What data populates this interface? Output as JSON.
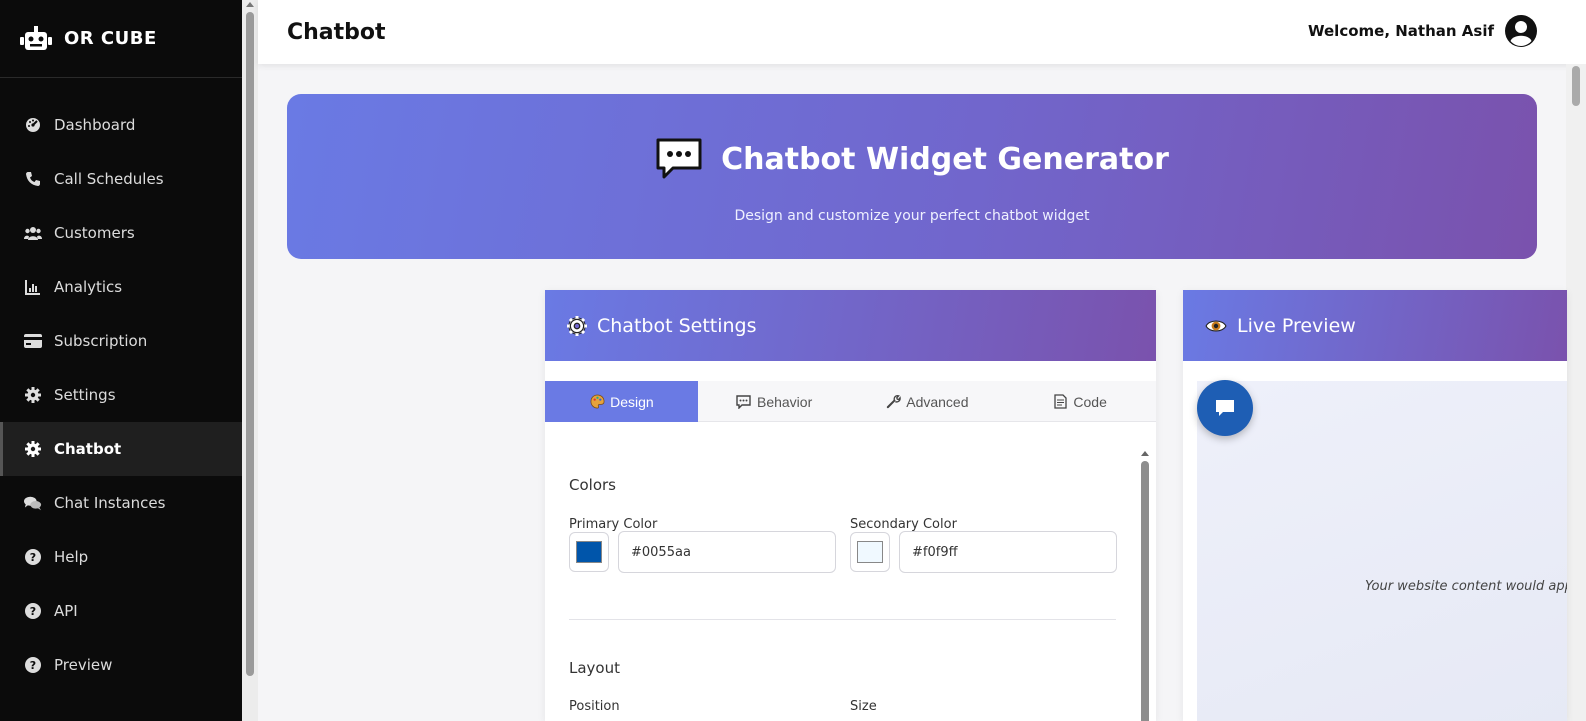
{
  "brand": {
    "name": "OR CUBE",
    "icon": "robot-icon"
  },
  "sidebar": {
    "items": [
      {
        "label": "Dashboard",
        "icon": "dashboard-icon",
        "active": false
      },
      {
        "label": "Call Schedules",
        "icon": "phone-icon",
        "active": false
      },
      {
        "label": "Customers",
        "icon": "users-icon",
        "active": false
      },
      {
        "label": "Analytics",
        "icon": "chart-icon",
        "active": false
      },
      {
        "label": "Subscription",
        "icon": "credit-card-icon",
        "active": false
      },
      {
        "label": "Settings",
        "icon": "gear-icon",
        "active": false
      },
      {
        "label": "Chatbot",
        "icon": "gear-icon",
        "active": true
      },
      {
        "label": "Chat Instances",
        "icon": "comments-icon",
        "active": false
      },
      {
        "label": "Help",
        "icon": "question-icon",
        "active": false
      },
      {
        "label": "API",
        "icon": "question-icon",
        "active": false
      },
      {
        "label": "Preview",
        "icon": "question-icon",
        "active": false
      }
    ]
  },
  "header": {
    "title": "Chatbot",
    "welcome": "Welcome, Nathan Asif",
    "avatar_icon": "user-circle-icon"
  },
  "hero": {
    "title": "Chatbot Widget Generator",
    "subtitle": "Design and customize your perfect chatbot widget",
    "icon": "chat-icon"
  },
  "settings": {
    "title": "Chatbot Settings",
    "icon": "gear-icon",
    "tabs": [
      {
        "label": "Design",
        "icon": "palette-icon",
        "active": true
      },
      {
        "label": "Behavior",
        "icon": "message-icon",
        "active": false
      },
      {
        "label": "Advanced",
        "icon": "wrench-icon",
        "active": false
      },
      {
        "label": "Code",
        "icon": "document-icon",
        "active": false
      }
    ],
    "colors_section": "Colors",
    "primary_label": "Primary Color",
    "primary_value": "#0055aa",
    "secondary_label": "Secondary Color",
    "secondary_value": "#f0f9ff",
    "layout_section": "Layout",
    "position_label": "Position",
    "size_label": "Size"
  },
  "preview": {
    "title": "Live Preview",
    "icon": "eye-icon",
    "content_text": "Your website content would appe",
    "chat_button_icon": "chat-bubble-icon"
  },
  "colors": {
    "accent_start": "#6a7ae4",
    "accent_end": "#7a52ad",
    "sidebar_bg": "#0b0b0b",
    "chat_button": "#1e5eb4"
  }
}
